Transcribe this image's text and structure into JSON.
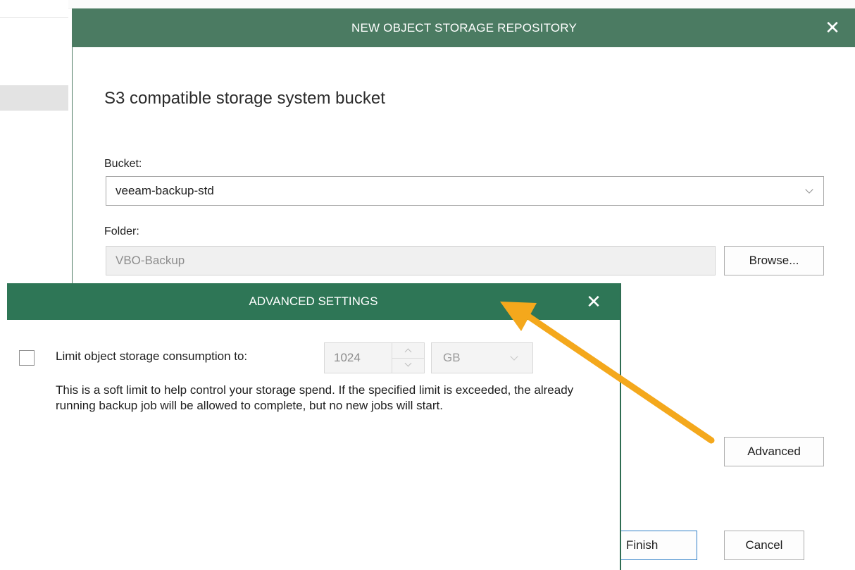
{
  "main_dialog": {
    "title": "NEW OBJECT STORAGE REPOSITORY",
    "close_glyph": "✕",
    "heading": "S3 compatible storage system bucket",
    "bucket_label": "Bucket:",
    "bucket_value": "veeam-backup-std",
    "folder_label": "Folder:",
    "folder_value": "VBO-Backup",
    "browse_label": "Browse...",
    "advanced_label": "Advanced",
    "finish_label": "Finish",
    "cancel_label": "Cancel"
  },
  "advanced_dialog": {
    "title": "ADVANCED SETTINGS",
    "close_glyph": "✕",
    "limit_label": "Limit object storage consumption to:",
    "limit_checked": false,
    "limit_value": "1024",
    "unit_value": "GB",
    "hint": "This is a soft limit to help control your storage spend. If the specified limit is exceeded, the already running backup job will be allowed to complete, but no new jobs will start."
  },
  "colors": {
    "main_titlebar": "#4b7b62",
    "advanced_titlebar": "#2e7656",
    "annotation_arrow": "#f4a81c",
    "finish_border": "#2f7fc7"
  },
  "icons": {
    "close": "close-icon",
    "dropdown": "chevron-down-icon",
    "spin_up": "chevron-up-icon",
    "spin_down": "chevron-down-icon",
    "annotation": "annotation-arrow"
  }
}
